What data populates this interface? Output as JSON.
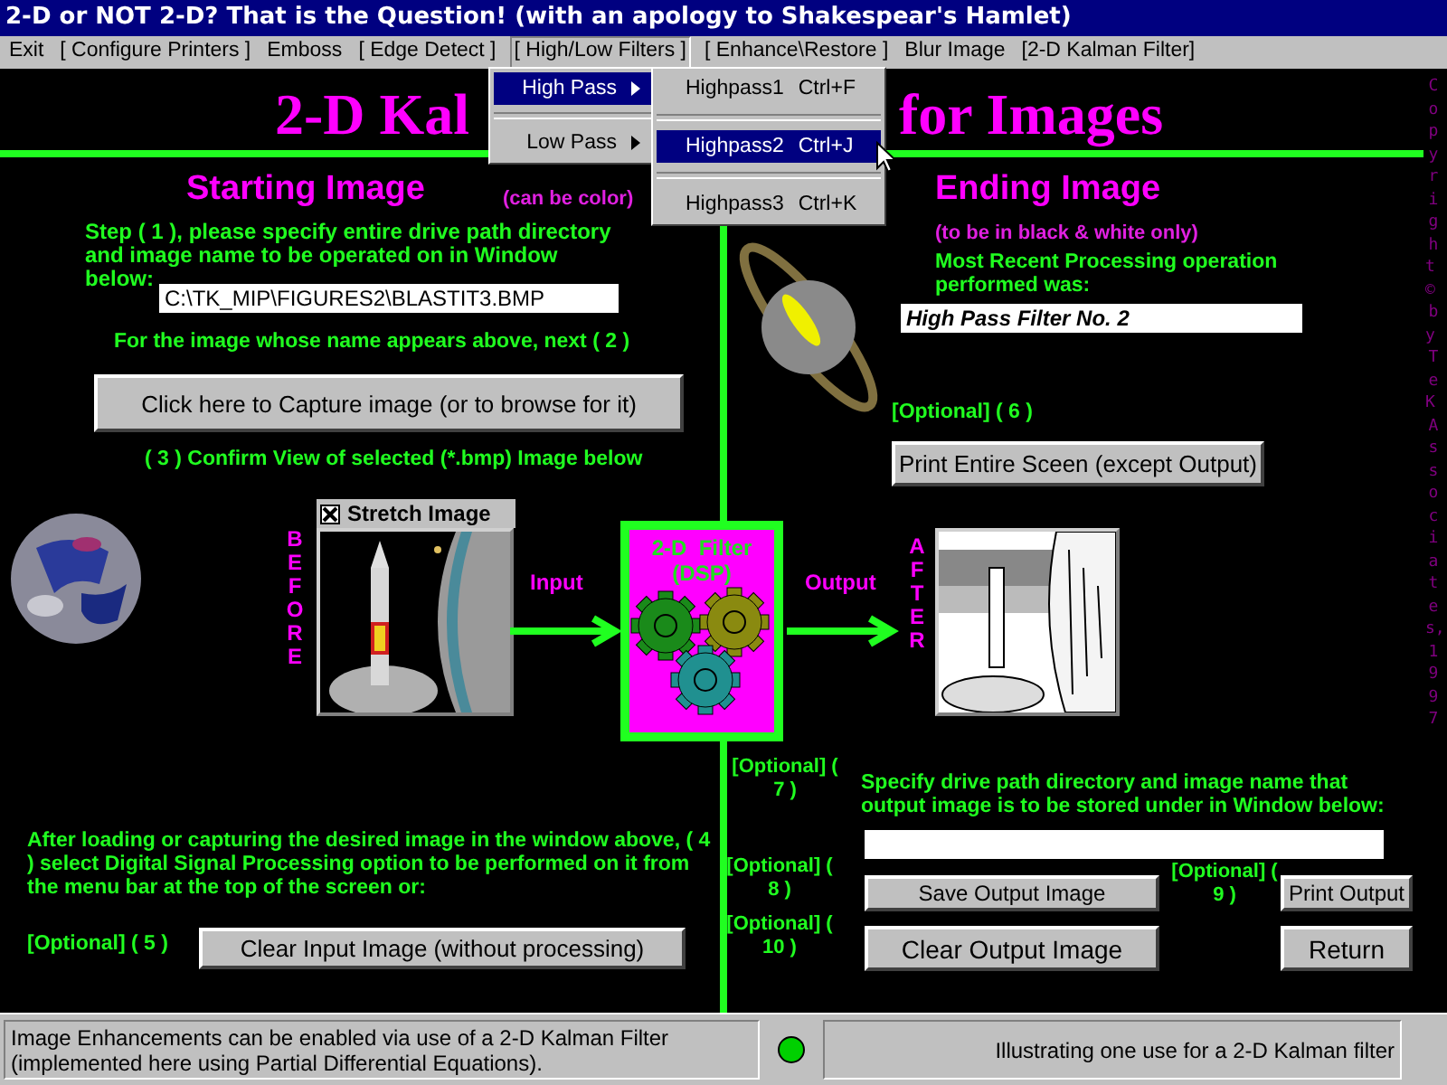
{
  "window": {
    "title": "2-D or NOT 2-D? That is the Question! (with an apology to Shakespear's Hamlet)"
  },
  "menu_bar": [
    {
      "label": "Exit",
      "selected": false
    },
    {
      "label": "[ Configure Printers ]",
      "selected": false
    },
    {
      "label": "Emboss",
      "selected": false
    },
    {
      "label": "[ Edge Detect ]",
      "selected": false
    },
    {
      "label": "[ High/Low Filters ]",
      "selected": true
    },
    {
      "label": "[ Enhance\\Restore ]",
      "selected": false
    },
    {
      "label": "Blur Image",
      "selected": false
    },
    {
      "label": "[2-D Kalman Filter]",
      "selected": false
    }
  ],
  "dropdown": [
    {
      "label": "High Pass",
      "selected": true
    },
    {
      "label": "Low Pass",
      "selected": false
    }
  ],
  "submenu": [
    {
      "label": "Highpass1",
      "shortcut": "Ctrl+F",
      "selected": false
    },
    {
      "label": "Highpass2",
      "shortcut": "Ctrl+J",
      "selected": true
    },
    {
      "label": "Highpass3",
      "shortcut": "Ctrl+K",
      "selected": false
    }
  ],
  "banner": {
    "left": "2-D Kal",
    "right": "for Images"
  },
  "copyright": "Copyright © by TeK Associates, 1997",
  "start": {
    "heading": "Starting Image",
    "note": "(can be color)",
    "step1": "Step ( 1 ), please specify entire drive path directory and image name to be operated on in Window below:",
    "path": "C:\\TK_MIP\\FIGURES2\\BLASTIT3.BMP",
    "step2": "For the image whose name appears above, next ( 2 )",
    "capture_button": "Click here to Capture image (or to browse for it)",
    "step3": "( 3 ) Confirm View of selected (*.bmp) Image below",
    "stretch": {
      "label": "Stretch Image",
      "checked": true
    },
    "before": "BEFORE",
    "input": "Input",
    "step4": "After loading or capturing the desired image in the window above, ( 4 ) select Digital Signal Processing option to be performed on it from the menu bar at the top of the screen or:",
    "optional5": "[Optional] ( 5 )",
    "clear_input_button": "Clear Input Image (without processing)"
  },
  "filter": {
    "title": "2-D  Filter",
    "subtitle": "(DSP)"
  },
  "end": {
    "heading": "Ending Image",
    "note": "(to be in black & white only)",
    "recent": "Most Recent Processing operation performed was:",
    "operation": "High Pass Filter No. 2",
    "optional6": "[Optional] ( 6 )",
    "print_screen_button": "Print Entire Sceen (except Output)",
    "after": "AFTER",
    "output": "Output",
    "optional7": "[Optional] ( 7 )",
    "specify": "Specify drive path directory and image name that output image is to be stored under in Window below:",
    "optional8": "[Optional] ( 8 )",
    "save_button": "Save Output Image",
    "optional9": "[Optional] ( 9 )",
    "print_output_button": "Print Output",
    "optional10": "[Optional] ( 10 )",
    "clear_output_button": "Clear Output Image",
    "return_button": "Return"
  },
  "status_bar": {
    "left": "Image Enhancements can be enabled via use of a 2-D Kalman Filter (implemented here using Partial Differential Equations).",
    "indicator_on": true,
    "right": "Illustrating one use for a 2-D Kalman filter"
  }
}
